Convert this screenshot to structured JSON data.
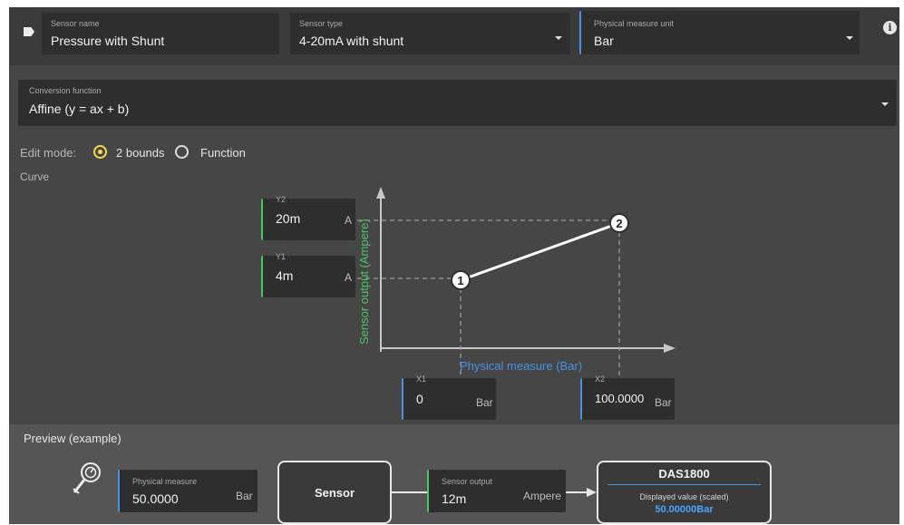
{
  "sensor_name": {
    "label": "Sensor name",
    "value": "Pressure with Shunt"
  },
  "sensor_type": {
    "label": "Sensor type",
    "value": "4-20mA with shunt"
  },
  "physical_unit": {
    "label": "Physical measure unit",
    "value": "Bar"
  },
  "conversion": {
    "label": "Conversion function",
    "value": "Affine (y = ax + b)"
  },
  "edit_mode": {
    "label": "Edit mode:",
    "options": [
      "2 bounds",
      "Function"
    ],
    "selected": "2 bounds"
  },
  "curve_label": "Curve",
  "bounds": {
    "y2": {
      "label": "Y2",
      "value": "20m",
      "unit": "A"
    },
    "y1": {
      "label": "Y1",
      "value": "4m",
      "unit": "A"
    },
    "x1": {
      "label": "X1",
      "value": "0",
      "unit": "Bar"
    },
    "x2": {
      "label": "X2",
      "value": "100.0000",
      "unit": "Bar"
    }
  },
  "chart": {
    "y_axis_label": "Sensor output (Ampere)",
    "x_axis_label": "Physical measure (Bar)",
    "point_labels": [
      "1",
      "2"
    ]
  },
  "preview": {
    "title": "Preview (example)",
    "physical_measure": {
      "label": "Physical measure",
      "value": "50.0000",
      "unit": "Bar"
    },
    "sensor_box": "Sensor",
    "sensor_output": {
      "label": "Sensor output",
      "value": "12m",
      "unit": "Ampere"
    },
    "device": {
      "name": "DAS1800",
      "label": "Displayed value (scaled)",
      "value": "50.00000Bar"
    }
  },
  "icons": [
    "label-tag-icon",
    "dropdown-caret-icon",
    "info-icon",
    "gauge-probe-icon"
  ],
  "colors": {
    "blue_accent": "#4a90e2",
    "green_accent": "#4cc466",
    "radio_selected": "#f5d84a",
    "value_blue": "#4aa3ff"
  }
}
